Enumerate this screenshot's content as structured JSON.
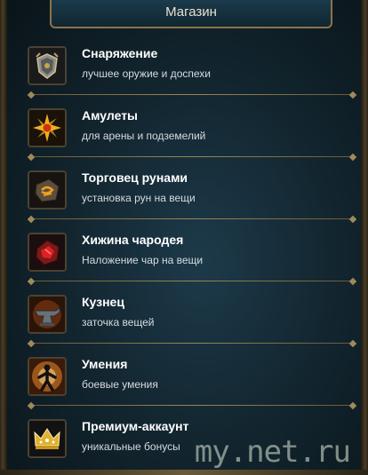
{
  "header": {
    "title": "Магазин"
  },
  "items": [
    {
      "title": "Снаряжение",
      "subtitle": "лучшее оружие и доспехи",
      "icon": "armor-shield-icon"
    },
    {
      "title": "Амулеты",
      "subtitle": "для арены и подземелий",
      "icon": "amulet-icon"
    },
    {
      "title": "Торговец рунами",
      "subtitle": "установка рун на вещи",
      "icon": "rune-icon"
    },
    {
      "title": "Хижина чародея",
      "subtitle": "Наложение чар на вещи",
      "icon": "enchant-crystal-icon"
    },
    {
      "title": "Кузнец",
      "subtitle": "заточка вещей",
      "icon": "anvil-icon"
    },
    {
      "title": "Умения",
      "subtitle": "боевые умения",
      "icon": "skill-figure-icon"
    },
    {
      "title": "Премиум-аккаунт",
      "subtitle": "уникальные бонусы",
      "icon": "crown-icon"
    }
  ],
  "watermark": "my.net.ru"
}
